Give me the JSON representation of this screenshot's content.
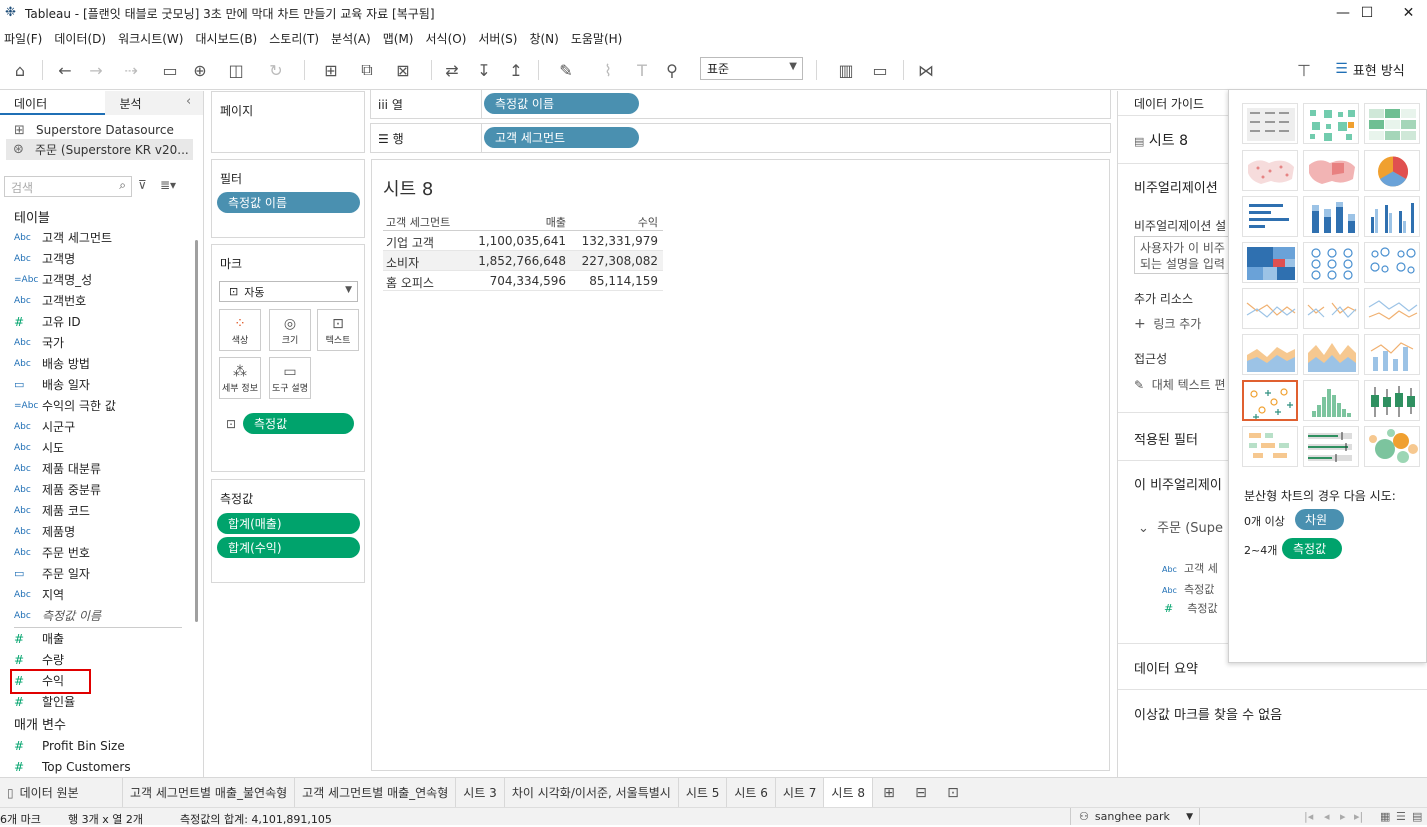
{
  "window": {
    "title": "Tableau - [플랜잇 태블로 굿모닝] 3초 만에 막대 차트 만들기 교육 자료 [복구됨]",
    "min": "—",
    "max": "☐",
    "close": "✕"
  },
  "menu": [
    "파일(F)",
    "데이터(D)",
    "워크시트(W)",
    "대시보드(B)",
    "스토리(T)",
    "분석(A)",
    "맵(M)",
    "서식(O)",
    "서버(S)",
    "창(N)",
    "도움말(H)"
  ],
  "toolbar": {
    "fit_select": "표준",
    "show_me_label": "표현 방식"
  },
  "left_panel": {
    "tab_data": "데이터",
    "tab_analysis": "분석",
    "datasources": [
      "Superstore Datasource",
      "주문 (Superstore KR v20..."
    ],
    "search_placeholder": "검색",
    "tables_header": "테이블",
    "dimensions": [
      {
        "type": "Abc",
        "name": "고객 세그먼트"
      },
      {
        "type": "Abc",
        "name": "고객명"
      },
      {
        "type": "=Abc",
        "name": "고객명_성"
      },
      {
        "type": "Abc",
        "name": "고객번호"
      },
      {
        "type": "#",
        "name": "고유 ID"
      },
      {
        "type": "Abc",
        "name": "국가"
      },
      {
        "type": "Abc",
        "name": "배송 방법"
      },
      {
        "type": "date",
        "name": "배송 일자"
      },
      {
        "type": "=Abc",
        "name": "수익의 극한 값"
      },
      {
        "type": "Abc",
        "name": "시군구"
      },
      {
        "type": "Abc",
        "name": "시도"
      },
      {
        "type": "Abc",
        "name": "제품 대분류"
      },
      {
        "type": "Abc",
        "name": "제품 중분류"
      },
      {
        "type": "Abc",
        "name": "제품 코드"
      },
      {
        "type": "Abc",
        "name": "제품명"
      },
      {
        "type": "Abc",
        "name": "주문 번호"
      },
      {
        "type": "date",
        "name": "주문 일자"
      },
      {
        "type": "Abc",
        "name": "지역"
      },
      {
        "type": "Abc",
        "name": "측정값 이름"
      }
    ],
    "measures": [
      "매출",
      "수량",
      "수익",
      "할인율"
    ],
    "params_header": "매개 변수",
    "params": [
      "Profit Bin Size",
      "Top Customers"
    ]
  },
  "cards": {
    "pages": "페이지",
    "filters": "필터",
    "filter_pill": "측정값 이름",
    "marks": "마크",
    "marks_type": "자동",
    "mark_buttons": [
      "색상",
      "크기",
      "텍스트",
      "세부 정보",
      "도구 설명"
    ],
    "marks_pill": "측정값",
    "measure_values": "측정값",
    "mv_pills": [
      "합계(매출)",
      "합계(수익)"
    ]
  },
  "shelves": {
    "columns_label": "열",
    "columns_pill": "측정값 이름",
    "rows_label": "행",
    "rows_pill": "고객 세그먼트"
  },
  "sheet": {
    "title": "시트 8",
    "headers": [
      "고객 세그먼트",
      "매출",
      "수익"
    ],
    "rows": [
      [
        "기업 고객",
        "1,100,035,641",
        "132,331,979"
      ],
      [
        "소비자",
        "1,852,766,648",
        "227,308,082"
      ],
      [
        "홈 오피스",
        "704,334,596",
        "85,114,159"
      ]
    ]
  },
  "right_panel": {
    "tab": "데이터 가이드",
    "sheet": "시트 8",
    "viz_desc": "비주얼리제이션",
    "viz_desc_label": "비주얼리제이션 설",
    "desc_box_1": "사용자가 이 비주",
    "desc_box_2": "되는 설명을 입력",
    "resources": "추가 리소스",
    "add_link": "링크 추가",
    "accessibility": "접근성",
    "alt_text": "대체 텍스트 편",
    "applied_filters": "적용된 필터",
    "this_viz": "이 비주얼리제이",
    "ds_node": "주문 (Supe",
    "fields": [
      {
        "type": "Abc",
        "name": "고객 세"
      },
      {
        "type": "Abc",
        "name": "측정값"
      },
      {
        "type": "#",
        "name": "측정값"
      }
    ],
    "data_summary": "데이터 요약",
    "outliers": "이상값 마크를 찾을 수 없음"
  },
  "show_me": {
    "hint": "분산형 차트의 경우 다음 시도:",
    "line1_prefix": "0개 이상",
    "line1_pill": "차원",
    "line2_prefix": "2~4개",
    "line2_pill": "측정값"
  },
  "sheet_tabs": [
    "데이터 원본",
    "고객 세그먼트별 매출_불연속형",
    "고객 세그먼트별 매출_연속형",
    "시트 3",
    "차이 시각화/이서준, 서울특별시",
    "시트 5",
    "시트 6",
    "시트 7",
    "시트 8"
  ],
  "status": {
    "marks": "6개 마크",
    "rowcol": "행 3개 x 열 2개",
    "sum": "측정값의 합계: 4,101,891,105",
    "user": "sanghee park"
  },
  "colors": {
    "accent": "#1f6fb5",
    "pill_blue": "#4a90b0",
    "pill_green": "#00a36c",
    "highlight": "#e00000"
  }
}
